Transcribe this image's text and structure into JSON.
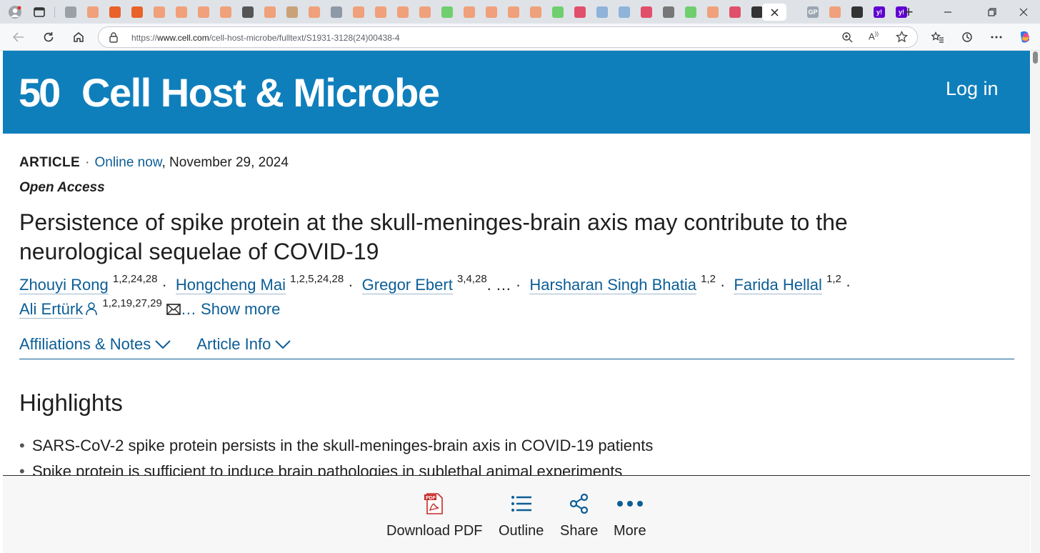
{
  "browser": {
    "url_prefix": "https://",
    "url_host": "www.cell.com",
    "url_path": "/cell-host-microbe/fulltext/S1931-3128(24)00438-4",
    "tab_favicons": [
      "profile-icon",
      "tab-actions-icon",
      "chrome-ball-icon",
      "bookmark-orange",
      "bookmark-orange-filled",
      "bookmark-orange-filled",
      "bookmark-orange",
      "bookmark-orange",
      "bookmark-orange",
      "bookmark-orange",
      "script-icon",
      "bookmark-orange",
      "eagle-icon",
      "bookmark-orange",
      "reel-icon",
      "bookmark-orange",
      "bookmark-orange",
      "bookmark-orange",
      "bookmark-orange",
      "play-green",
      "bookmark-orange",
      "bookmark-orange",
      "bookmark-orange",
      "bookmark-orange",
      "play-green",
      "youtube-icon",
      "puzzle-icon",
      "search-icon",
      "youtube-icon",
      "robot-icon",
      "play-green",
      "bookmark-orange",
      "youtube-icon",
      "monkey-icon",
      "active-close",
      "gp-icon",
      "bookmark-orange",
      "monkey-icon",
      "yahoo-icon",
      "yahoo-icon"
    ],
    "tab_gp_label": "GP",
    "tab_yahoo_label": "y!",
    "new_tab": "+"
  },
  "header": {
    "logo_mark": "50",
    "brand": "Cell Host & Microbe",
    "login": "Log in"
  },
  "article": {
    "type": "ARTICLE",
    "online_now": "Online now",
    "date": ", November 29, 2024",
    "open_access": "Open Access",
    "title": "Persistence of spike protein at the skull-meninges-brain axis may contribute to the neurological sequelae of COVID-19",
    "authors": [
      {
        "name": "Zhouyi Rong",
        "aff": "1,2,24,28"
      },
      {
        "name": "Hongcheng Mai",
        "aff": "1,2,5,24,28"
      },
      {
        "name": "Gregor Ebert",
        "aff": "3,4,28"
      },
      {
        "name": "Harsharan Singh Bhatia",
        "aff": "1,2"
      },
      {
        "name": "Farida Hellal",
        "aff": "1,2"
      },
      {
        "name": "Ali Ertürk",
        "aff": "1,2,19,27,29"
      }
    ],
    "ellipsis": "…",
    "show_more": "… Show more",
    "tabs": [
      "Affiliations & Notes",
      "Article Info"
    ],
    "highlights_heading": "Highlights",
    "highlights": [
      "SARS-CoV-2 spike protein persists in the skull-meninges-brain axis in COVID-19 patients",
      "Spike protein is sufficient to induce brain pathologies in sublethal animal experiments"
    ]
  },
  "toolbar": {
    "download_pdf": "Download PDF",
    "outline": "Outline",
    "share": "Share",
    "more": "More"
  },
  "colors": {
    "brand_blue": "#0f7fbc",
    "link_blue": "#0c5e96"
  }
}
